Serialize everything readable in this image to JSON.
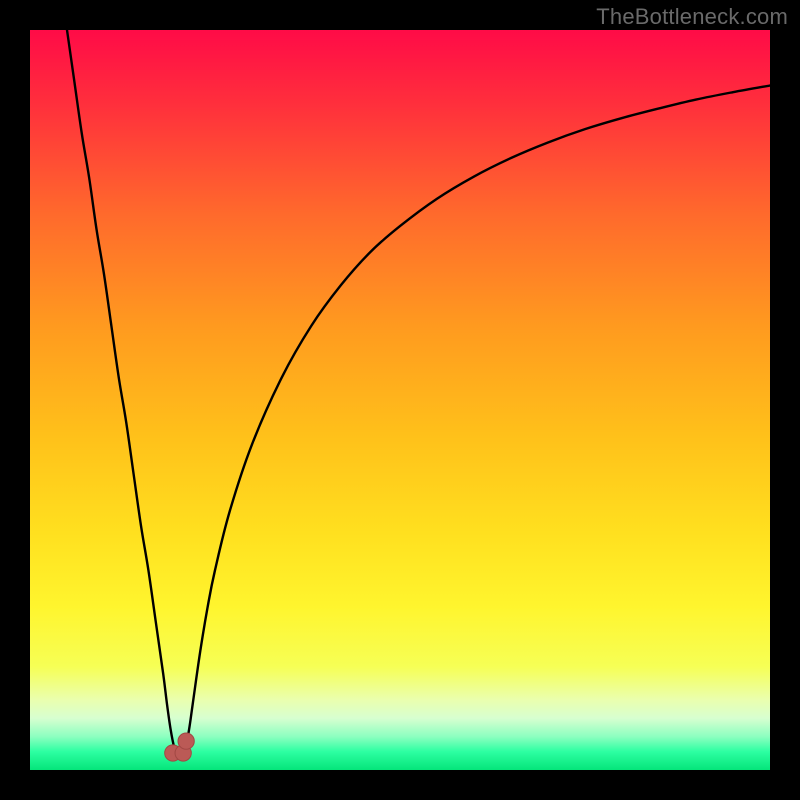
{
  "watermark": "TheBottleneck.com",
  "colors": {
    "frame": "#000000",
    "curve": "#000000",
    "marker_fill": "#bb5a56",
    "marker_stroke": "#a24844",
    "gradient_stops": [
      {
        "offset": 0.0,
        "color": "#ff0b47"
      },
      {
        "offset": 0.1,
        "color": "#ff2f3c"
      },
      {
        "offset": 0.25,
        "color": "#ff6a2c"
      },
      {
        "offset": 0.4,
        "color": "#ff9a1f"
      },
      {
        "offset": 0.55,
        "color": "#ffc11a"
      },
      {
        "offset": 0.68,
        "color": "#ffe01f"
      },
      {
        "offset": 0.78,
        "color": "#fff52e"
      },
      {
        "offset": 0.86,
        "color": "#f6ff55"
      },
      {
        "offset": 0.905,
        "color": "#eaffae"
      },
      {
        "offset": 0.93,
        "color": "#d7ffd0"
      },
      {
        "offset": 0.955,
        "color": "#8cffc0"
      },
      {
        "offset": 0.975,
        "color": "#2dffa2"
      },
      {
        "offset": 1.0,
        "color": "#05e57a"
      }
    ]
  },
  "chart_data": {
    "type": "line",
    "title": "",
    "xlabel": "",
    "ylabel": "",
    "xlim": [
      0,
      100
    ],
    "ylim": [
      0,
      100
    ],
    "grid": false,
    "legend": false,
    "notch_x": 20,
    "series": [
      {
        "name": "bottleneck-curve",
        "x": [
          5,
          6,
          7,
          8,
          9,
          10,
          11,
          12,
          13,
          14,
          15,
          16,
          17,
          18,
          18.5,
          19,
          19.5,
          20,
          20.5,
          21,
          21.5,
          22,
          23,
          24,
          25,
          27,
          30,
          34,
          38,
          42,
          46,
          50,
          55,
          60,
          65,
          70,
          75,
          80,
          85,
          90,
          95,
          100
        ],
        "y": [
          100,
          93,
          86,
          80,
          73,
          67,
          60,
          53,
          47,
          40,
          33,
          27,
          20,
          13,
          9,
          5.5,
          3,
          1.6,
          2.0,
          3.0,
          5.5,
          9,
          16,
          22,
          27,
          35,
          44,
          53,
          60,
          65.5,
          70,
          73.5,
          77.2,
          80.2,
          82.7,
          84.8,
          86.6,
          88.1,
          89.4,
          90.6,
          91.6,
          92.5
        ]
      }
    ],
    "markers": {
      "name": "notch-markers",
      "points": [
        {
          "x": 19.3,
          "y": 2.3
        },
        {
          "x": 20.7,
          "y": 2.3
        },
        {
          "x": 21.1,
          "y": 3.9
        }
      ],
      "radius_pct": 1.1
    }
  }
}
